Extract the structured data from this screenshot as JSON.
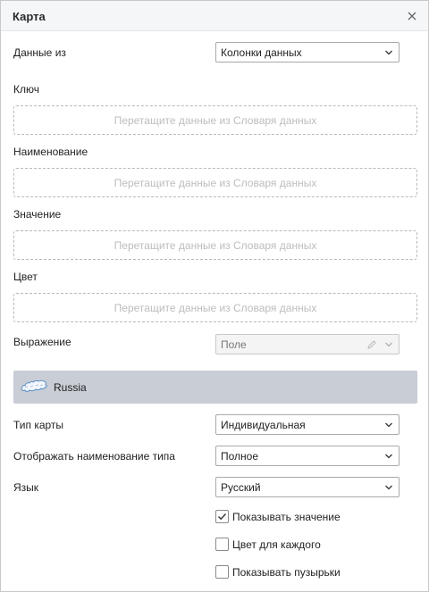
{
  "dialog": {
    "title": "Карта",
    "close_icon": "close-icon"
  },
  "fields": {
    "data_from": {
      "label": "Данные из",
      "value": "Колонки данных"
    },
    "key": {
      "label": "Ключ",
      "placeholder": "Перетащите данные из Словаря данных"
    },
    "name": {
      "label": "Наименование",
      "placeholder": "Перетащите данные из Словаря данных"
    },
    "value": {
      "label": "Значение",
      "placeholder": "Перетащите данные из Словаря данных"
    },
    "color": {
      "label": "Цвет",
      "placeholder": "Перетащите данные из Словаря данных"
    },
    "expression": {
      "label": "Выражение",
      "value": "Поле",
      "icon": "pencil-icon"
    }
  },
  "map": {
    "name": "Russia",
    "icon": "russia-map-icon"
  },
  "settings": {
    "map_type": {
      "label": "Тип карты",
      "value": "Индивидуальная"
    },
    "display_type_name": {
      "label": "Отображать наименование типа",
      "value": "Полное"
    },
    "language": {
      "label": "Язык",
      "value": "Русский"
    }
  },
  "checkboxes": [
    {
      "label": "Показывать значение",
      "checked": true
    },
    {
      "label": "Цвет для каждого",
      "checked": false
    },
    {
      "label": "Показывать пузырьки",
      "checked": false
    }
  ],
  "colors": {
    "map_band": "#c8cdd6",
    "placeholder_text": "#bdbdbd",
    "border": "#a9a9a9"
  }
}
